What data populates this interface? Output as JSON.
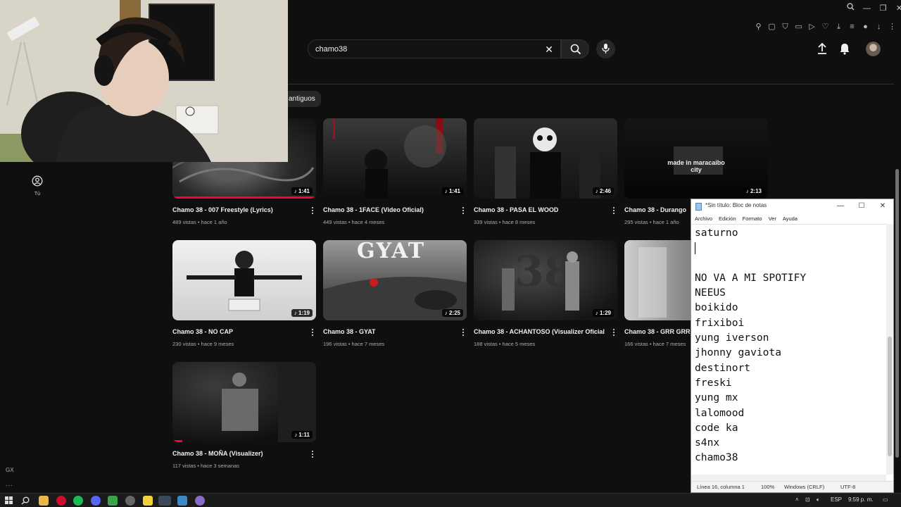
{
  "search": {
    "query": "chamo38"
  },
  "filter_chip": {
    "label": "antiguos"
  },
  "sidebar": {
    "you_label": "Tú",
    "gx_label": "GX",
    "more_label": "..."
  },
  "videos": [
    {
      "title": "Chamo 38 - 007 Freestyle (Lyrics)",
      "meta": "489 vistas • hace 1 año",
      "duration": "1:41",
      "watched": 1.0
    },
    {
      "title": "Chamo 38 - 1FACE (Video Oficial)",
      "meta": "449 vistas • hace 4 meses",
      "duration": "1:41",
      "watched": 0
    },
    {
      "title": "Chamo 38 - PASA EL WOOD",
      "meta": "339 vistas • hace 8 meses",
      "duration": "2:46",
      "watched": 0
    },
    {
      "title": "Chamo 38 - Durango",
      "meta": "295 vistas • hace 1 año",
      "duration": "2:13",
      "watched": 0
    },
    {
      "title": "Chamo 38 - NO CAP",
      "meta": "230 vistas • hace 9 meses",
      "duration": "1:19",
      "watched": 0
    },
    {
      "title": "Chamo 38 - GYAT",
      "meta": "196 vistas • hace 7 meses",
      "duration": "2:25",
      "watched": 0
    },
    {
      "title": "Chamo 38 - ACHANTOSO (Visualizer Oficial)",
      "meta": "188 vistas • hace 5 meses",
      "duration": "1:29",
      "watched": 0
    },
    {
      "title": "Chamo 38 - GRR GRR",
      "meta": "166 vistas • hace 7 meses",
      "duration": "",
      "watched": 0
    },
    {
      "title": "Chamo 38 - MOÑA (Visualizer)",
      "meta": "117 vistas • hace 3 semanas",
      "duration": "1:11",
      "watched": 0.07
    }
  ],
  "thumb_texts": {
    "gyat": "GYAT",
    "durango": "made in maracaibo city",
    "achantoso": "38"
  },
  "notepad": {
    "title": "*Sin título: Bloc de notas",
    "menu": [
      "Archivo",
      "Edición",
      "Formato",
      "Ver",
      "Ayuda"
    ],
    "lines": [
      "saturno",
      "",
      "",
      "NO VA A MI SPOTIFY",
      "NEEUS",
      "boikido",
      "frixiboi",
      "yung iverson",
      "jhonny gaviota",
      "destinort",
      "freski",
      "yung mx",
      "lalomood",
      "code ka",
      "s4nx",
      "chamo38"
    ],
    "status": {
      "position": "Línea 16, columna 1",
      "zoom": "100%",
      "eol": "Windows (CRLF)",
      "encoding": "UTF-8"
    }
  },
  "taskbar": {
    "lang": "ESP",
    "time": "9:59 p. m."
  },
  "colors": {
    "accent_red": "#ff0033",
    "page_bg": "#0f0f0f"
  }
}
